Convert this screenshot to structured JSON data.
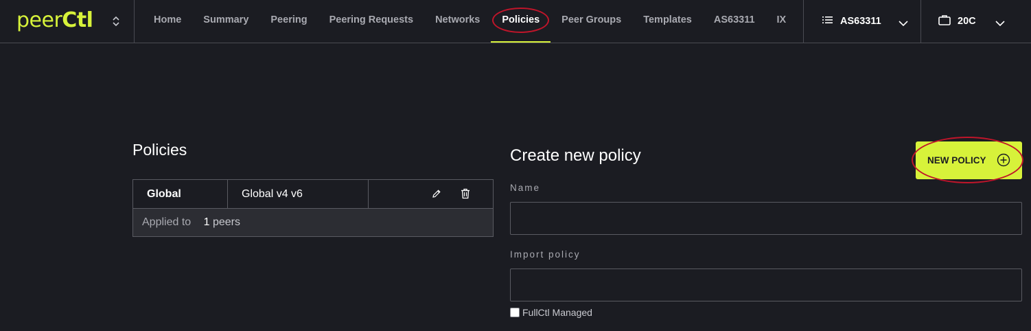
{
  "app": {
    "logo_main": "peer",
    "logo_accent": "Ctl"
  },
  "nav": {
    "items": [
      {
        "label": "Home"
      },
      {
        "label": "Summary"
      },
      {
        "label": "Peering"
      },
      {
        "label": "Peering Requests"
      },
      {
        "label": "Networks"
      },
      {
        "label": "Policies",
        "active": true
      },
      {
        "label": "Peer Groups"
      },
      {
        "label": "Templates"
      },
      {
        "label": "AS63311"
      },
      {
        "label": "IX"
      }
    ]
  },
  "asn_selector": {
    "value": "AS63311",
    "icon": "list-icon"
  },
  "org_selector": {
    "value": "20C",
    "icon": "briefcase-icon"
  },
  "policies": {
    "title": "Policies",
    "rows": [
      {
        "name": "Global",
        "description": "Global v4 v6",
        "applied_prefix": "Applied to",
        "applied_count": "1",
        "applied_unit": "peers"
      }
    ]
  },
  "create_form": {
    "title": "Create new policy",
    "new_button_label": "NEW POLICY",
    "name_label": "Name",
    "name_value": "",
    "import_label": "Import policy",
    "import_value": "",
    "fullctl_managed_label": "FullCtl Managed",
    "fullctl_managed_checked": false
  },
  "colors": {
    "accent": "#d7f23a",
    "background": "#1b1c22",
    "highlight_ring": "#c0152a"
  }
}
